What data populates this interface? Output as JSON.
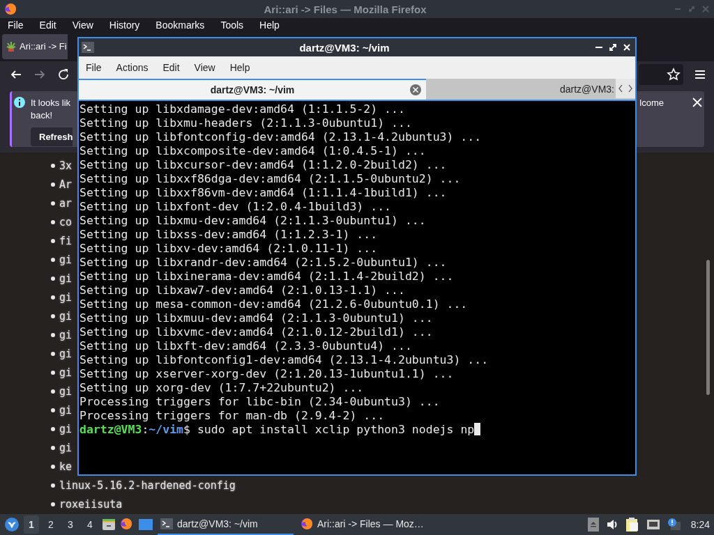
{
  "firefox": {
    "title": "Ari::ari -> Files — Mozilla Firefox",
    "menu": [
      "File",
      "Edit",
      "View",
      "History",
      "Bookmarks",
      "Tools",
      "Help"
    ],
    "tabs": [
      {
        "label": "Ari::ari -> Fi",
        "selected": true
      }
    ],
    "notification": {
      "line_1": "It looks lik",
      "line_2": "back!",
      "button": "Refresh",
      "right_text": "lcome"
    },
    "list": [
      "3x",
      "Ar",
      "ar",
      "co",
      "fi",
      "gi",
      "gi",
      "gi",
      "gi",
      "gi",
      "gi",
      "gi",
      "gi",
      "gi",
      "gi",
      "gi",
      "ke",
      "linux-5.16.2-hardened-config",
      "roxeiisuta"
    ]
  },
  "terminal": {
    "title": "dartz@VM3: ~/vim",
    "menu": [
      "File",
      "Actions",
      "Edit",
      "View",
      "Help"
    ],
    "tabs": [
      {
        "label": "dartz@VM3: ~/vim",
        "selected": true
      },
      {
        "label": "dartz@VM3:",
        "selected": false
      }
    ],
    "lines": [
      "Setting up libxdamage-dev:amd64 (1:1.1.5-2) ...",
      "Setting up libxmu-headers (2:1.1.3-0ubuntu1) ...",
      "Setting up libfontconfig-dev:amd64 (2.13.1-4.2ubuntu3) ...",
      "Setting up libxcomposite-dev:amd64 (1:0.4.5-1) ...",
      "Setting up libxcursor-dev:amd64 (1:1.2.0-2build2) ...",
      "Setting up libxxf86dga-dev:amd64 (2:1.1.5-0ubuntu2) ...",
      "Setting up libxxf86vm-dev:amd64 (1:1.1.4-1build1) ...",
      "Setting up libxfont-dev (1:2.0.4-1build3) ...",
      "Setting up libxmu-dev:amd64 (2:1.1.3-0ubuntu1) ...",
      "Setting up libxss-dev:amd64 (1:1.2.3-1) ...",
      "Setting up libxv-dev:amd64 (2:1.0.11-1) ...",
      "Setting up libxrandr-dev:amd64 (2:1.5.2-0ubuntu1) ...",
      "Setting up libxinerama-dev:amd64 (2:1.1.4-2build2) ...",
      "Setting up libxaw7-dev:amd64 (2:1.0.13-1.1) ...",
      "Setting up mesa-common-dev:amd64 (21.2.6-0ubuntu0.1) ...",
      "Setting up libxmuu-dev:amd64 (2:1.1.3-0ubuntu1) ...",
      "Setting up libxvmc-dev:amd64 (2:1.0.12-2build1) ...",
      "Setting up libxft-dev:amd64 (2.3.3-0ubuntu4) ...",
      "Setting up libfontconfig1-dev:amd64 (2.13.1-4.2ubuntu3) ...",
      "Setting up xserver-xorg-dev (2:1.20.13-1ubuntu1.1) ...",
      "Setting up xorg-dev (1:7.7+22ubuntu2) ...",
      "Processing triggers for libc-bin (2.34-0ubuntu3) ...",
      "Processing triggers for man-db (2.9.4-2) ..."
    ],
    "prompt": {
      "user_host": "dartz@VM3",
      "separator": ":",
      "path": "~/vim",
      "symbol": "$",
      "command": "sudo apt install xclip python3 nodejs np"
    }
  },
  "taskbar": {
    "workspaces": [
      {
        "label": "1",
        "selected": true
      },
      {
        "label": "2",
        "selected": false
      },
      {
        "label": "3",
        "selected": false
      },
      {
        "label": "4",
        "selected": false
      }
    ],
    "tasks": [
      {
        "label": "dartz@VM3: ~/vim",
        "kind": "terminal",
        "selected": true
      },
      {
        "label": "Ari::ari -> Files — Moz…",
        "kind": "browser",
        "selected": false
      }
    ],
    "clock": "8:24"
  }
}
